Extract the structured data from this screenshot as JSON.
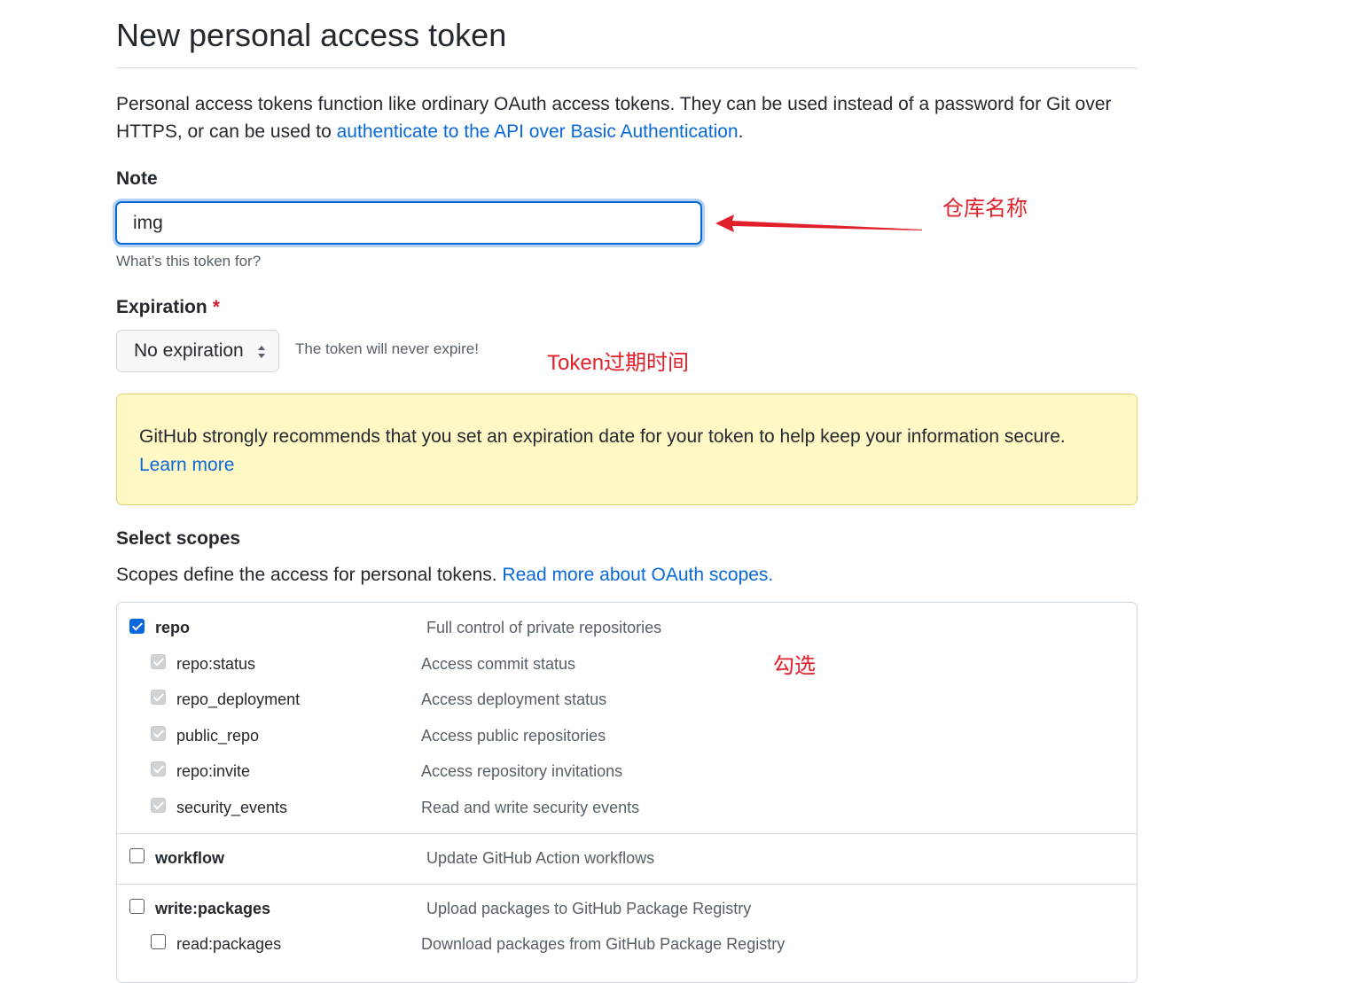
{
  "page": {
    "title": "New personal access token"
  },
  "intro": {
    "text_before": "Personal access tokens function like ordinary OAuth access tokens. They can be used instead of a password for Git over HTTPS, or can be used to ",
    "link": "authenticate to the API over Basic Authentication",
    "text_after": "."
  },
  "note": {
    "label": "Note",
    "value": "img",
    "hint": "What’s this token for?"
  },
  "expiration": {
    "label": "Expiration",
    "required_mark": "*",
    "selected": "No expiration",
    "note": "The token will never expire!"
  },
  "flash": {
    "message": "GitHub strongly recommends that you set an expiration date for your token to help keep your information secure.",
    "link": "Learn more",
    "bg_color": "#fff8c5"
  },
  "scopes": {
    "title": "Select scopes",
    "description": "Scopes define the access for personal tokens. ",
    "description_link": "Read more about OAuth scopes.",
    "groups": [
      {
        "name": "repo",
        "description": "Full control of private repositories",
        "checked": true,
        "children": [
          {
            "name": "repo:status",
            "description": "Access commit status",
            "checked": true
          },
          {
            "name": "repo_deployment",
            "description": "Access deployment status",
            "checked": true
          },
          {
            "name": "public_repo",
            "description": "Access public repositories",
            "checked": true
          },
          {
            "name": "repo:invite",
            "description": "Access repository invitations",
            "checked": true
          },
          {
            "name": "security_events",
            "description": "Read and write security events",
            "checked": true
          }
        ]
      },
      {
        "name": "workflow",
        "description": "Update GitHub Action workflows",
        "checked": false,
        "children": []
      },
      {
        "name": "write:packages",
        "description": "Upload packages to GitHub Package Registry",
        "checked": false,
        "children": [
          {
            "name": "read:packages",
            "description": "Download packages from GitHub Package Registry",
            "checked": false
          }
        ]
      }
    ]
  },
  "annotations": {
    "repo_name": "仓库名称",
    "expiration": "Token过期时间",
    "check": "勾选",
    "color": "#e0202a"
  },
  "colors": {
    "link": "#0969da",
    "checkbox_checked": "#0969da",
    "required": "#cf222e"
  }
}
